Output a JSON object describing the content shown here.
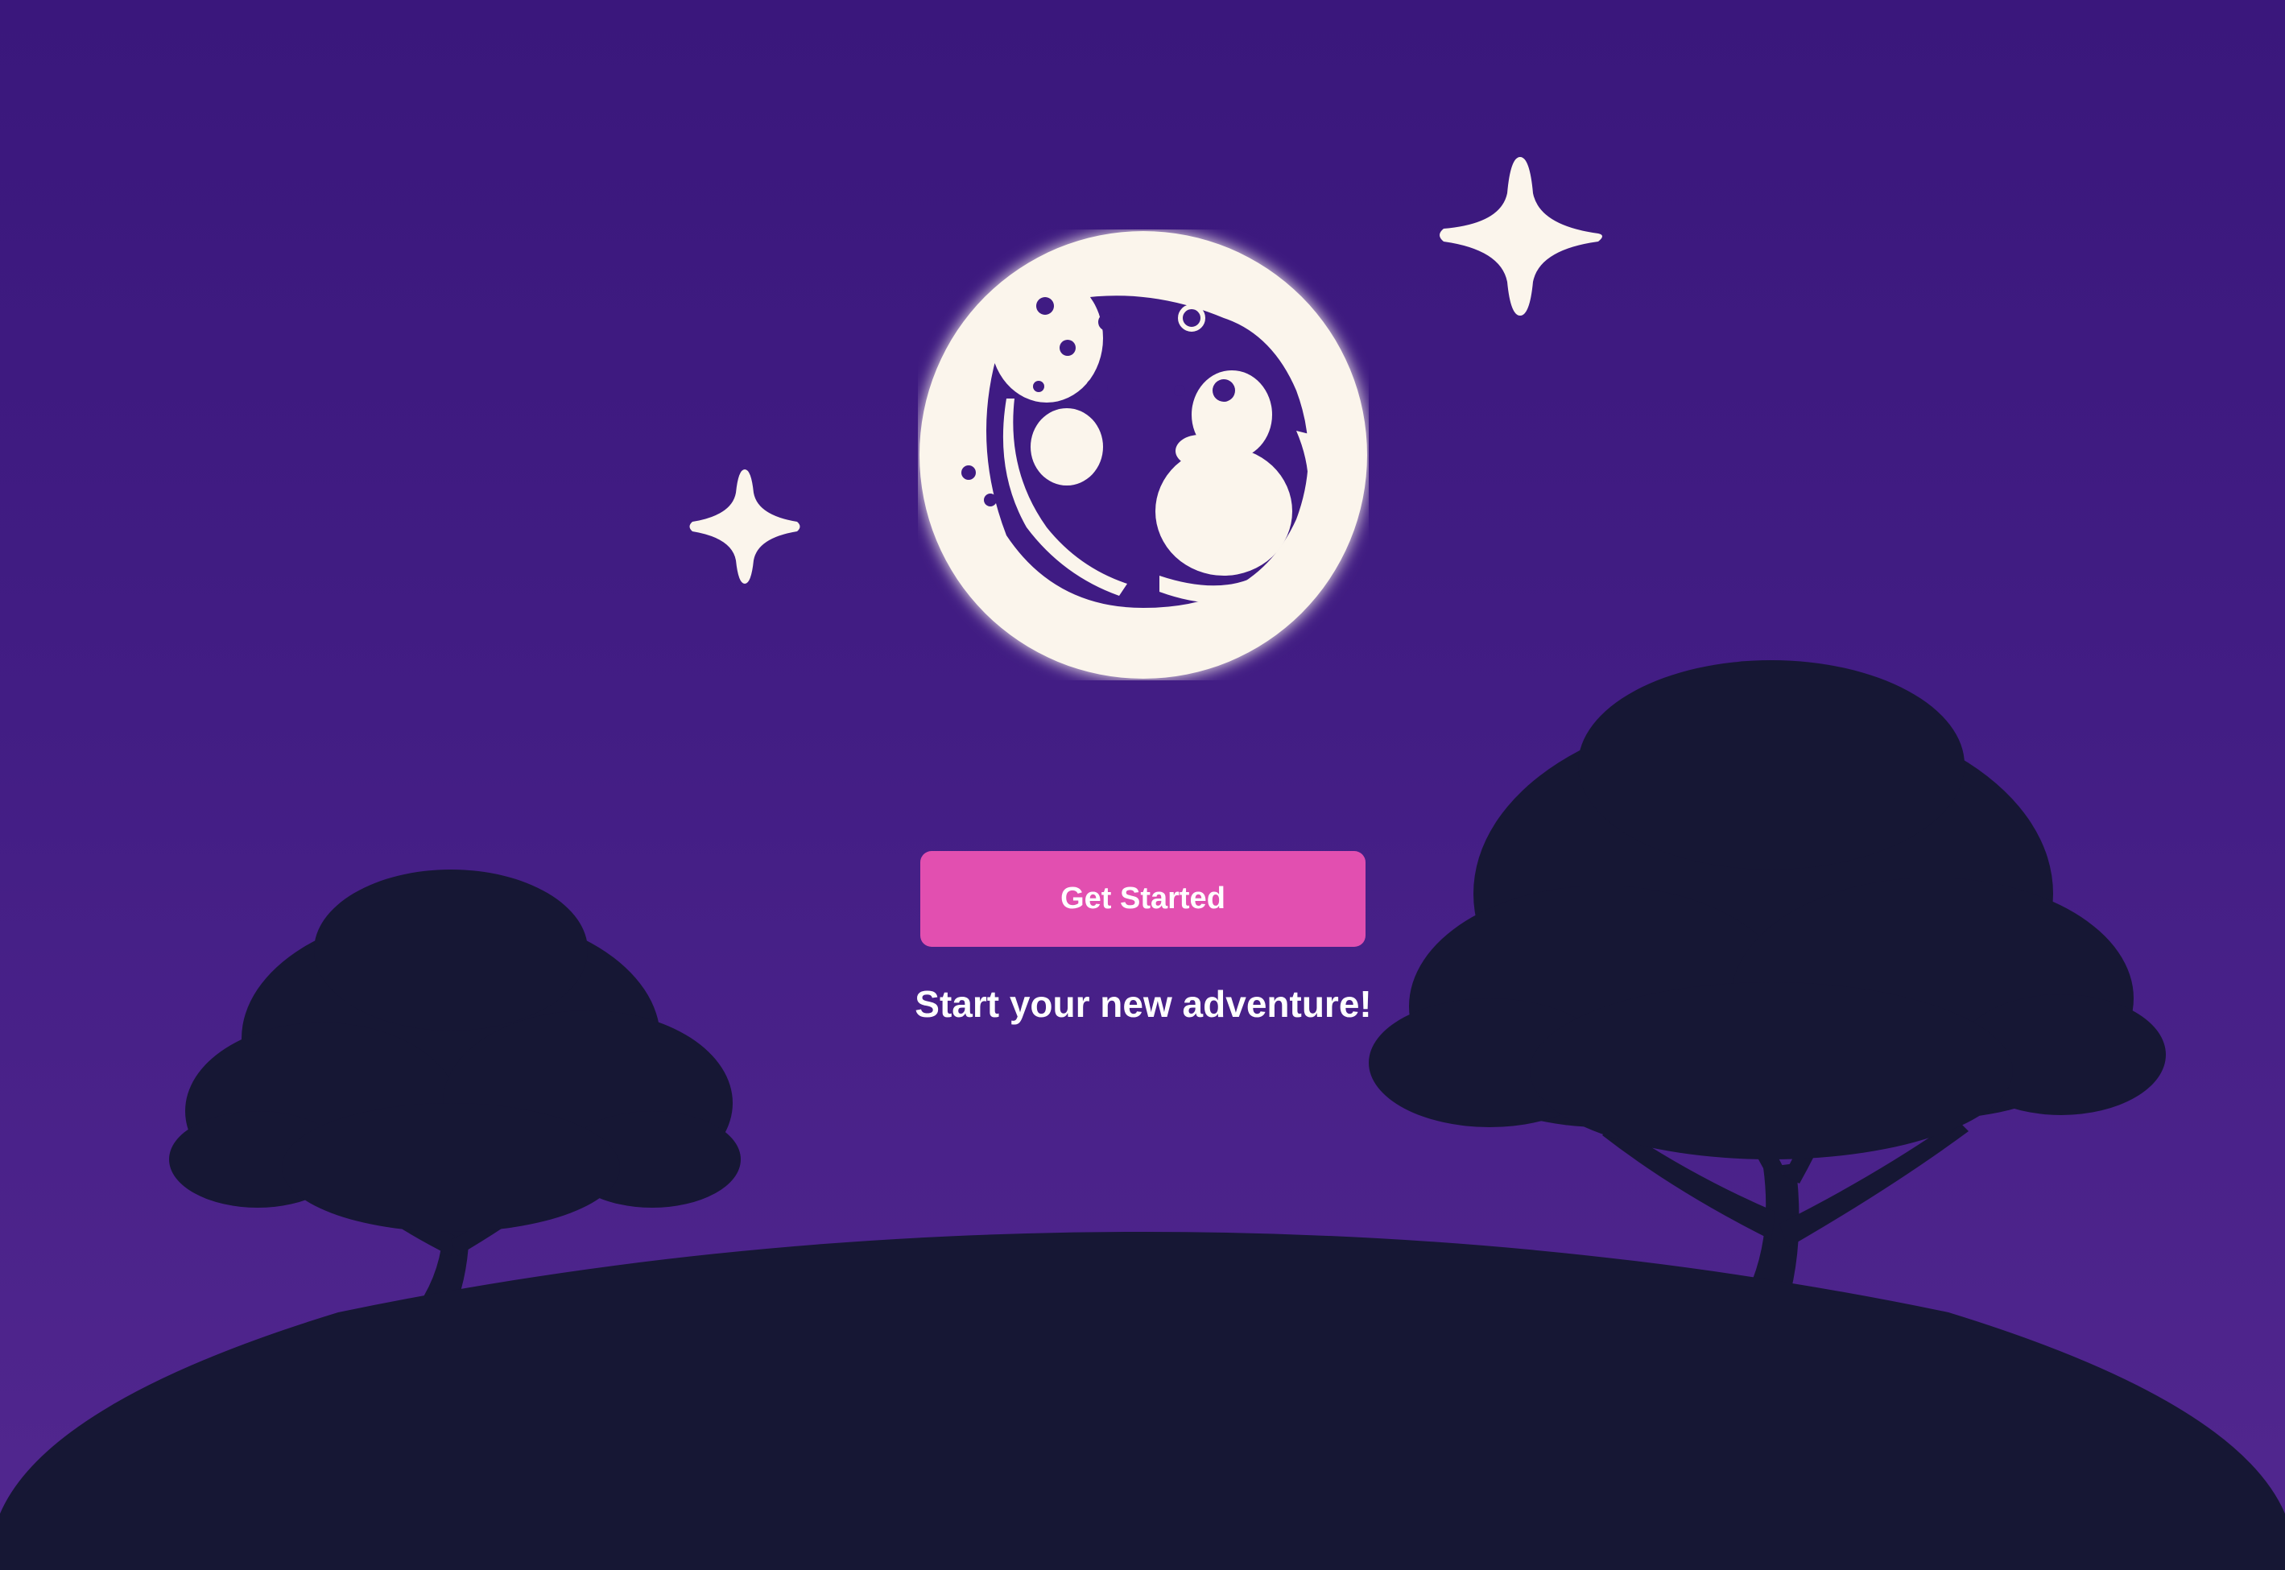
{
  "colors": {
    "sky_top": "#3a177c",
    "sky_bottom": "#52278f",
    "hill": "#161734",
    "trees": "#161734",
    "moon": "#fbf5ec",
    "button": "#e24fb0",
    "text": "#ffffff"
  },
  "logo": {
    "icon": "moon-logo-icon"
  },
  "decor": {
    "star_icon": "sparkle-star-icon",
    "tree_icon": "tree-silhouette-icon",
    "hill_icon": "hill-silhouette"
  },
  "cta": {
    "label": "Get Started"
  },
  "tagline": {
    "text": "Start your new adventure!"
  }
}
